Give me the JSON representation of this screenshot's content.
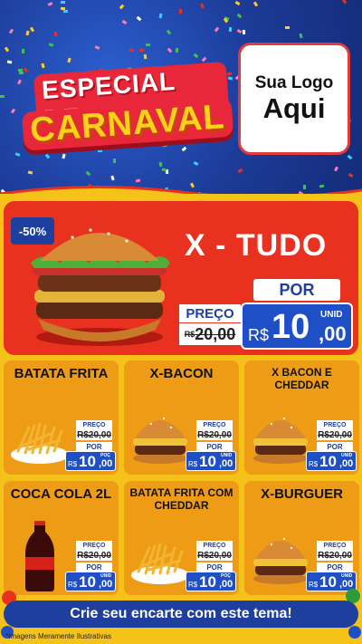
{
  "header": {
    "title_line1": "ESPECIAL DE",
    "title_line2": "CARNAVAL",
    "logo_line1": "Sua Logo",
    "logo_line2": "Aqui"
  },
  "featured": {
    "discount": "-50%",
    "name": "X - TUDO",
    "preco_label": "PREÇO",
    "old_currency": "R$",
    "old_price": "20,00",
    "por_label": "POR",
    "currency": "R$",
    "price_int": "10",
    "price_dec": ",00",
    "unit": "UNID"
  },
  "products": [
    {
      "name": "BATATA FRITA",
      "icon": "fries-icon",
      "preco_label": "PREÇO",
      "old_price": "R$20,00",
      "por_label": "POR",
      "currency": "R$",
      "price_int": "10",
      "price_dec": ",00",
      "unit": "POÇ"
    },
    {
      "name": "X-BACON",
      "icon": "burger-icon",
      "preco_label": "PREÇO",
      "old_price": "R$20,00",
      "por_label": "POR",
      "currency": "R$",
      "price_int": "10",
      "price_dec": ",00",
      "unit": "UNID"
    },
    {
      "name": "X BACON E CHEDDAR",
      "icon": "burger-icon",
      "preco_label": "PREÇO",
      "old_price": "R$20,00",
      "por_label": "POR",
      "currency": "R$",
      "price_int": "10",
      "price_dec": ",00",
      "unit": "UNID"
    },
    {
      "name": "COCA COLA 2L",
      "icon": "soda-bottle-icon",
      "preco_label": "PREÇO",
      "old_price": "R$20,00",
      "por_label": "POR",
      "currency": "R$",
      "price_int": "10",
      "price_dec": ",00",
      "unit": "UNID"
    },
    {
      "name": "BATATA FRITA COM CHEDDAR",
      "icon": "fries-icon",
      "preco_label": "PREÇO",
      "old_price": "R$20,00",
      "por_label": "POR",
      "currency": "R$",
      "price_int": "10",
      "price_dec": ",00",
      "unit": "POÇ"
    },
    {
      "name": "X-BURGUER",
      "icon": "burger-icon",
      "preco_label": "PREÇO",
      "old_price": "R$20,00",
      "por_label": "POR",
      "currency": "R$",
      "price_int": "10",
      "price_dec": ",00",
      "unit": "UNID"
    }
  ],
  "cta": "Crie seu encarte com este tema!",
  "footnote": "*Imagens Meramente Ilustrativas",
  "colors": {
    "header_blue": "#1c3fa0",
    "yellow": "#f5c21a",
    "orange": "#ee9b16",
    "red": "#e8321f",
    "price_blue": "#1f4fc6"
  }
}
